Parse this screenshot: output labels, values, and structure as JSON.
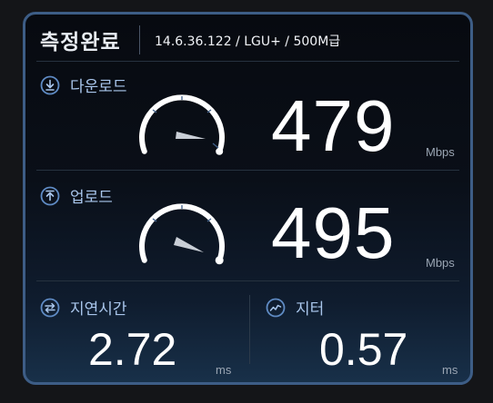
{
  "header": {
    "title": "측정완료",
    "server_info": "14.6.36.122 / LGU+ / 500M급"
  },
  "download": {
    "label": "다운로드",
    "icon": "download-arrow-icon",
    "value": "479",
    "unit": "Mbps"
  },
  "upload": {
    "label": "업로드",
    "icon": "upload-arrow-icon",
    "value": "495",
    "unit": "Mbps"
  },
  "latency": {
    "label": "지연시간",
    "icon": "swap-arrows-icon",
    "value": "2.72",
    "unit": "ms"
  },
  "jitter": {
    "label": "지터",
    "icon": "pulse-wave-icon",
    "value": "0.57",
    "unit": "ms"
  },
  "colors": {
    "accent": "#5f8bc4",
    "border": "#3d5d86",
    "label": "#a9c6ec",
    "value": "#ffffff"
  }
}
